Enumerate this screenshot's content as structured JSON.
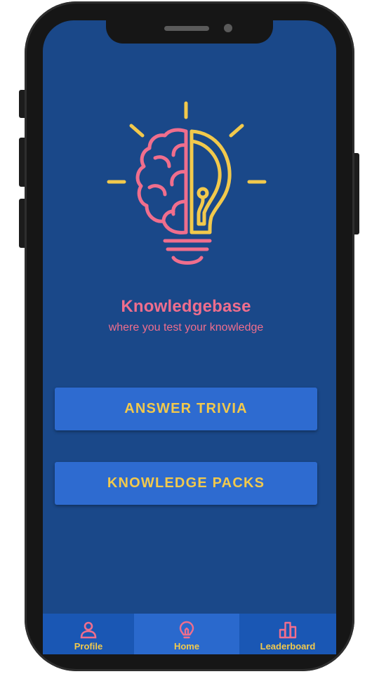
{
  "app": {
    "title": "Knowledgebase",
    "tagline": "where you test your knowledge"
  },
  "buttons": {
    "answer_trivia": "ANSWER TRIVIA",
    "knowledge_packs": "KNOWLEDGE PACKS"
  },
  "bottom_nav": {
    "items": [
      {
        "label": "Profile",
        "icon": "person-icon"
      },
      {
        "label": "Home",
        "icon": "lightbulb-icon",
        "active": true
      },
      {
        "label": "Leaderboard",
        "icon": "bar-chart-icon"
      }
    ]
  },
  "colors": {
    "screen_bg": "#1a4889",
    "button_bg": "#2e6bd0",
    "accent_yellow": "#f2c94c",
    "accent_pink": "#f06e8d",
    "nav_bg": "#1a57b4",
    "nav_active_bg": "#2a69cd"
  }
}
